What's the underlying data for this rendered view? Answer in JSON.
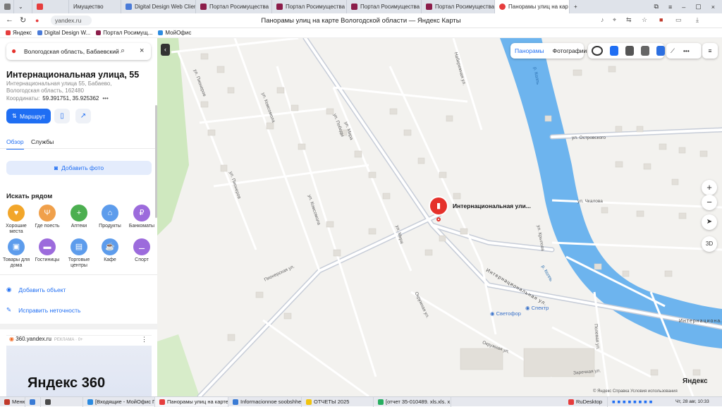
{
  "tabs": [
    {
      "label": "",
      "color": "#7a7a7a"
    },
    {
      "label": "",
      "color": "#e63d3d"
    },
    {
      "label": "Имущество",
      "color": "#e63d3d"
    },
    {
      "label": "Digital Design Web Client",
      "color": "#4a7bd8"
    },
    {
      "label": "Портал Росимущества",
      "color": "#8c1d4a"
    },
    {
      "label": "Портал Росимущества",
      "color": "#8c1d4a"
    },
    {
      "label": "Портал Росимущества",
      "color": "#8c1d4a"
    },
    {
      "label": "Портал Росимущества",
      "color": "#8c1d4a"
    },
    {
      "label": "Панорамы улиц на кар",
      "color": "#e63d3d"
    }
  ],
  "addressbar": {
    "domain": "yandex.ru",
    "title": "Панорамы улиц на карте Вологодской области — Яндекс Карты"
  },
  "bookmarks": [
    {
      "label": "Яндекс",
      "color": "#e63d3d"
    },
    {
      "label": "Digital Design W...",
      "color": "#4a7bd8"
    },
    {
      "label": "Портал Росимущ...",
      "color": "#8c1d4a"
    },
    {
      "label": "МойОфис",
      "color": "#2c8be0"
    }
  ],
  "sidebar": {
    "search_value": "Вологодская область, Бабаевский р",
    "title": "Интернациональная улица, 55",
    "address": "Интернациональная улица 55, Бабаево, Вологодская область, 162480",
    "coords_label": "Координаты:",
    "coords_value": "59.391751, 35.925362",
    "route_label": "Маршрут",
    "tabs": [
      "Обзор",
      "Службы"
    ],
    "add_photo": "Добавить фото",
    "nearby_title": "Искать рядом",
    "categories": [
      {
        "label": "Хорошие места",
        "color": "#f2a62a",
        "glyph": "♥"
      },
      {
        "label": "Где поесть",
        "color": "#f0a04b",
        "glyph": "Ψ"
      },
      {
        "label": "Аптеки",
        "color": "#4caf50",
        "glyph": "+"
      },
      {
        "label": "Продукты",
        "color": "#5d9cec",
        "glyph": "⌂"
      },
      {
        "label": "Банкоматы",
        "color": "#9c6bdc",
        "glyph": "₽"
      },
      {
        "label": "Товары для дома",
        "color": "#5d9cec",
        "glyph": "▣"
      },
      {
        "label": "Гостиницы",
        "color": "#9c6bdc",
        "glyph": "▬"
      },
      {
        "label": "Торговые центры",
        "color": "#5d9cec",
        "glyph": "▤"
      },
      {
        "label": "Кафе",
        "color": "#5d9cec",
        "glyph": "☕"
      },
      {
        "label": "Спорт",
        "color": "#9c6bdc",
        "glyph": "⚊"
      }
    ],
    "add_object": "Добавить объект",
    "fix_error": "Исправить неточность",
    "card_source": "360.yandex.ru",
    "card_ad": "РЕКЛАМА · 0+",
    "card_logo": "Яндекс 360"
  },
  "map": {
    "top_tabs": [
      "Панорамы",
      "Фотографии"
    ],
    "marker_label": "Интернациональная ули...",
    "poi": [
      "Светофор",
      "Спектр"
    ],
    "streets": [
      {
        "label": "ул. Пионеров"
      },
      {
        "label": "ул. Комсомола"
      },
      {
        "label": "ул. Победы"
      },
      {
        "label": "ул. Пионеров"
      },
      {
        "label": "ул. Комсомола"
      },
      {
        "label": "ул. Мира"
      },
      {
        "label": "ул. Мира"
      },
      {
        "label": "Набережная ул."
      },
      {
        "label": "ул. Островского"
      },
      {
        "label": "ул. Чкалова"
      },
      {
        "label": "ул. Крылова"
      },
      {
        "label": "р. Колпь"
      },
      {
        "label": "Интернациональная ул."
      },
      {
        "label": "Интернациональная ул."
      },
      {
        "label": "Окружная ул."
      },
      {
        "label": "Окружная ул."
      },
      {
        "label": "Заречная ул."
      },
      {
        "label": "Полевая ул."
      },
      {
        "label": "Пионерская ул."
      },
      {
        "label": "р. Колпь"
      }
    ],
    "zoom_in": "+",
    "zoom_out": "−",
    "mode_3d": "3D",
    "brand": "Яндекс",
    "footer": "© Яндекс  Справка  Условия использования"
  },
  "taskbar": [
    {
      "label": "Меню",
      "color": "#c0392b"
    },
    {
      "label": "",
      "color": "#3a7bd5"
    },
    {
      "label": "",
      "color": "#4a4a4a"
    },
    {
      "label": "[Входящие - МойОфис П...",
      "color": "#2c8be0"
    },
    {
      "label": "Панорамы улиц на карте...",
      "color": "#e63d3d"
    },
    {
      "label": "Informacionnoe soobshhe...",
      "color": "#3a7bd5"
    },
    {
      "label": "ОТЧЕТЫ 2025",
      "color": "#f1c40f"
    },
    {
      "label": "[отчет 35-010489. xls.xls. x...",
      "color": "#27ae60"
    },
    {
      "label": "RuDesktop",
      "color": "#e63d3d"
    },
    {
      "label": "Чт, 28 авг, 10:33",
      "color": "#e6e8ee"
    }
  ]
}
